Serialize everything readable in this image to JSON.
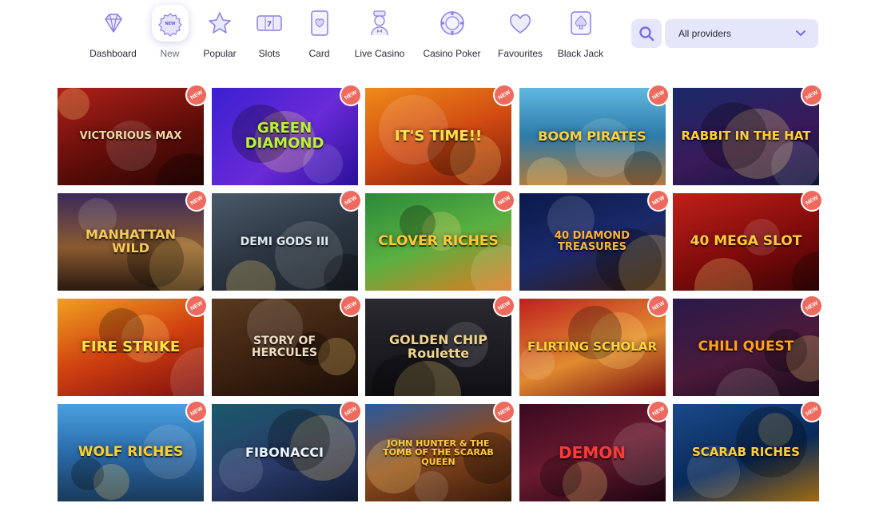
{
  "nav": [
    {
      "label": "Dashboard",
      "icon": "diamond-icon",
      "active": false
    },
    {
      "label": "New",
      "icon": "new-badge-icon",
      "active": true
    },
    {
      "label": "Popular",
      "icon": "star-icon",
      "active": false
    },
    {
      "label": "Slots",
      "icon": "slot-machine-icon",
      "active": false
    },
    {
      "label": "Card",
      "icon": "playing-card-icon",
      "active": false
    },
    {
      "label": "Live Casino",
      "icon": "dealer-icon",
      "active": false
    },
    {
      "label": "Casino Poker",
      "icon": "poker-chip-icon",
      "active": false
    },
    {
      "label": "Favourites",
      "icon": "heart-icon",
      "active": false
    },
    {
      "label": "Black Jack",
      "icon": "spade-card-icon",
      "active": false
    }
  ],
  "search": {
    "icon": "search-icon"
  },
  "provider_filter": {
    "selected": "All providers",
    "icon": "chevron-down-icon"
  },
  "badge_label": "NEW",
  "colors": {
    "accent": "#7b6be8",
    "select_bg": "#e6e6fa",
    "badge": "#ef6a5e"
  },
  "games": [
    {
      "title": "VICTORIOUS MAX",
      "bg": "linear-gradient(160deg,#b0201a,#5a0c08 60%,#2a0604)",
      "color": "#f2d7a0",
      "size": 13
    },
    {
      "title": "GREEN DIAMOND",
      "bg": "linear-gradient(135deg,#3a1fd0,#6a2bd8 55%,#2a0f9a)",
      "color": "#b9f23a",
      "size": 18
    },
    {
      "title": "IT'S TIME!!",
      "bg": "linear-gradient(160deg,#f08a1a,#d14b12 50%,#7a1c0a)",
      "color": "#ffe24a",
      "size": 18
    },
    {
      "title": "BOOM PIRATES",
      "bg": "linear-gradient(180deg,#5fb8e0,#2d7ba8 50%,#b07a40)",
      "color": "#ffd23a",
      "size": 16
    },
    {
      "title": "RABBIT IN THE HAT",
      "bg": "linear-gradient(160deg,#1a2a6a,#3a1a5a 55%,#10143a)",
      "color": "#ffcf3a",
      "size": 15
    },
    {
      "title": "MANHATTAN WILD",
      "bg": "linear-gradient(180deg,#3a2a5a,#8a5a30 55%,#2a1a10)",
      "color": "#f4c95a",
      "size": 16
    },
    {
      "title": "DEMI GODS III",
      "bg": "linear-gradient(160deg,#4a5a6a,#2a3440 55%,#1a2028)",
      "color": "#dfe7f0",
      "size": 14
    },
    {
      "title": "CLOVER RICHES",
      "bg": "linear-gradient(160deg,#2a8a3a,#5ab040 50%,#e07a20)",
      "color": "#ffc93a",
      "size": 17
    },
    {
      "title": "40 DIAMOND TREASURES",
      "bg": "linear-gradient(160deg,#0a1a4a,#1a2a6a 50%,#3a1a0a)",
      "color": "#ffb23a",
      "size": 13
    },
    {
      "title": "40 MEGA SLOT",
      "bg": "linear-gradient(160deg,#c0201a,#7a0a0a 60%,#3a0404)",
      "color": "#ffc93a",
      "size": 17
    },
    {
      "title": "FIRE STRIKE",
      "bg": "linear-gradient(160deg,#f0a020,#d04010 50%,#801010)",
      "color": "#ffe24a",
      "size": 18
    },
    {
      "title": "STORY OF HERCULES",
      "bg": "linear-gradient(160deg,#5a3a20,#3a2010 55%,#1a0c06)",
      "color": "#f0dcc0",
      "size": 14
    },
    {
      "title": "GOLDEN CHIP Roulette",
      "bg": "linear-gradient(180deg,#2a2a30,#1a1a20 60%,#101014)",
      "color": "#f0d48a",
      "size": 16
    },
    {
      "title": "FLIRTING SCHOLAR",
      "bg": "linear-gradient(160deg,#c02020,#e08a30 55%,#7a1010)",
      "color": "#ffd23a",
      "size": 15
    },
    {
      "title": "CHILI QUEST",
      "bg": "linear-gradient(160deg,#2a1a4a,#4a1a3a 55%,#1a0a1a)",
      "color": "#ffa21a",
      "size": 17
    },
    {
      "title": "WOLF RICHES",
      "bg": "linear-gradient(180deg,#4aa0e0,#2a6aa8 50%,#1a3a5a)",
      "color": "#ffcf2a",
      "size": 17
    },
    {
      "title": "FIBONACCI",
      "bg": "linear-gradient(160deg,#1a5a6a,#2a3a6a 55%,#101a30)",
      "color": "#e8f4ff",
      "size": 16
    },
    {
      "title": "JOHN HUNTER & THE TOMB OF THE SCARAB QUEEN",
      "bg": "linear-gradient(160deg,#2a5aa0,#8a4a20 50%,#3a1a0a)",
      "color": "#ffc93a",
      "size": 11
    },
    {
      "title": "DEMON",
      "bg": "linear-gradient(160deg,#3a0a20,#6a1a30 50%,#1a0410)",
      "color": "#ff3a3a",
      "size": 20
    },
    {
      "title": "SCARAB RICHES",
      "bg": "linear-gradient(160deg,#1a4a8a,#0a2a5a 55%,#a06a10)",
      "color": "#ffcf3a",
      "size": 15
    }
  ]
}
